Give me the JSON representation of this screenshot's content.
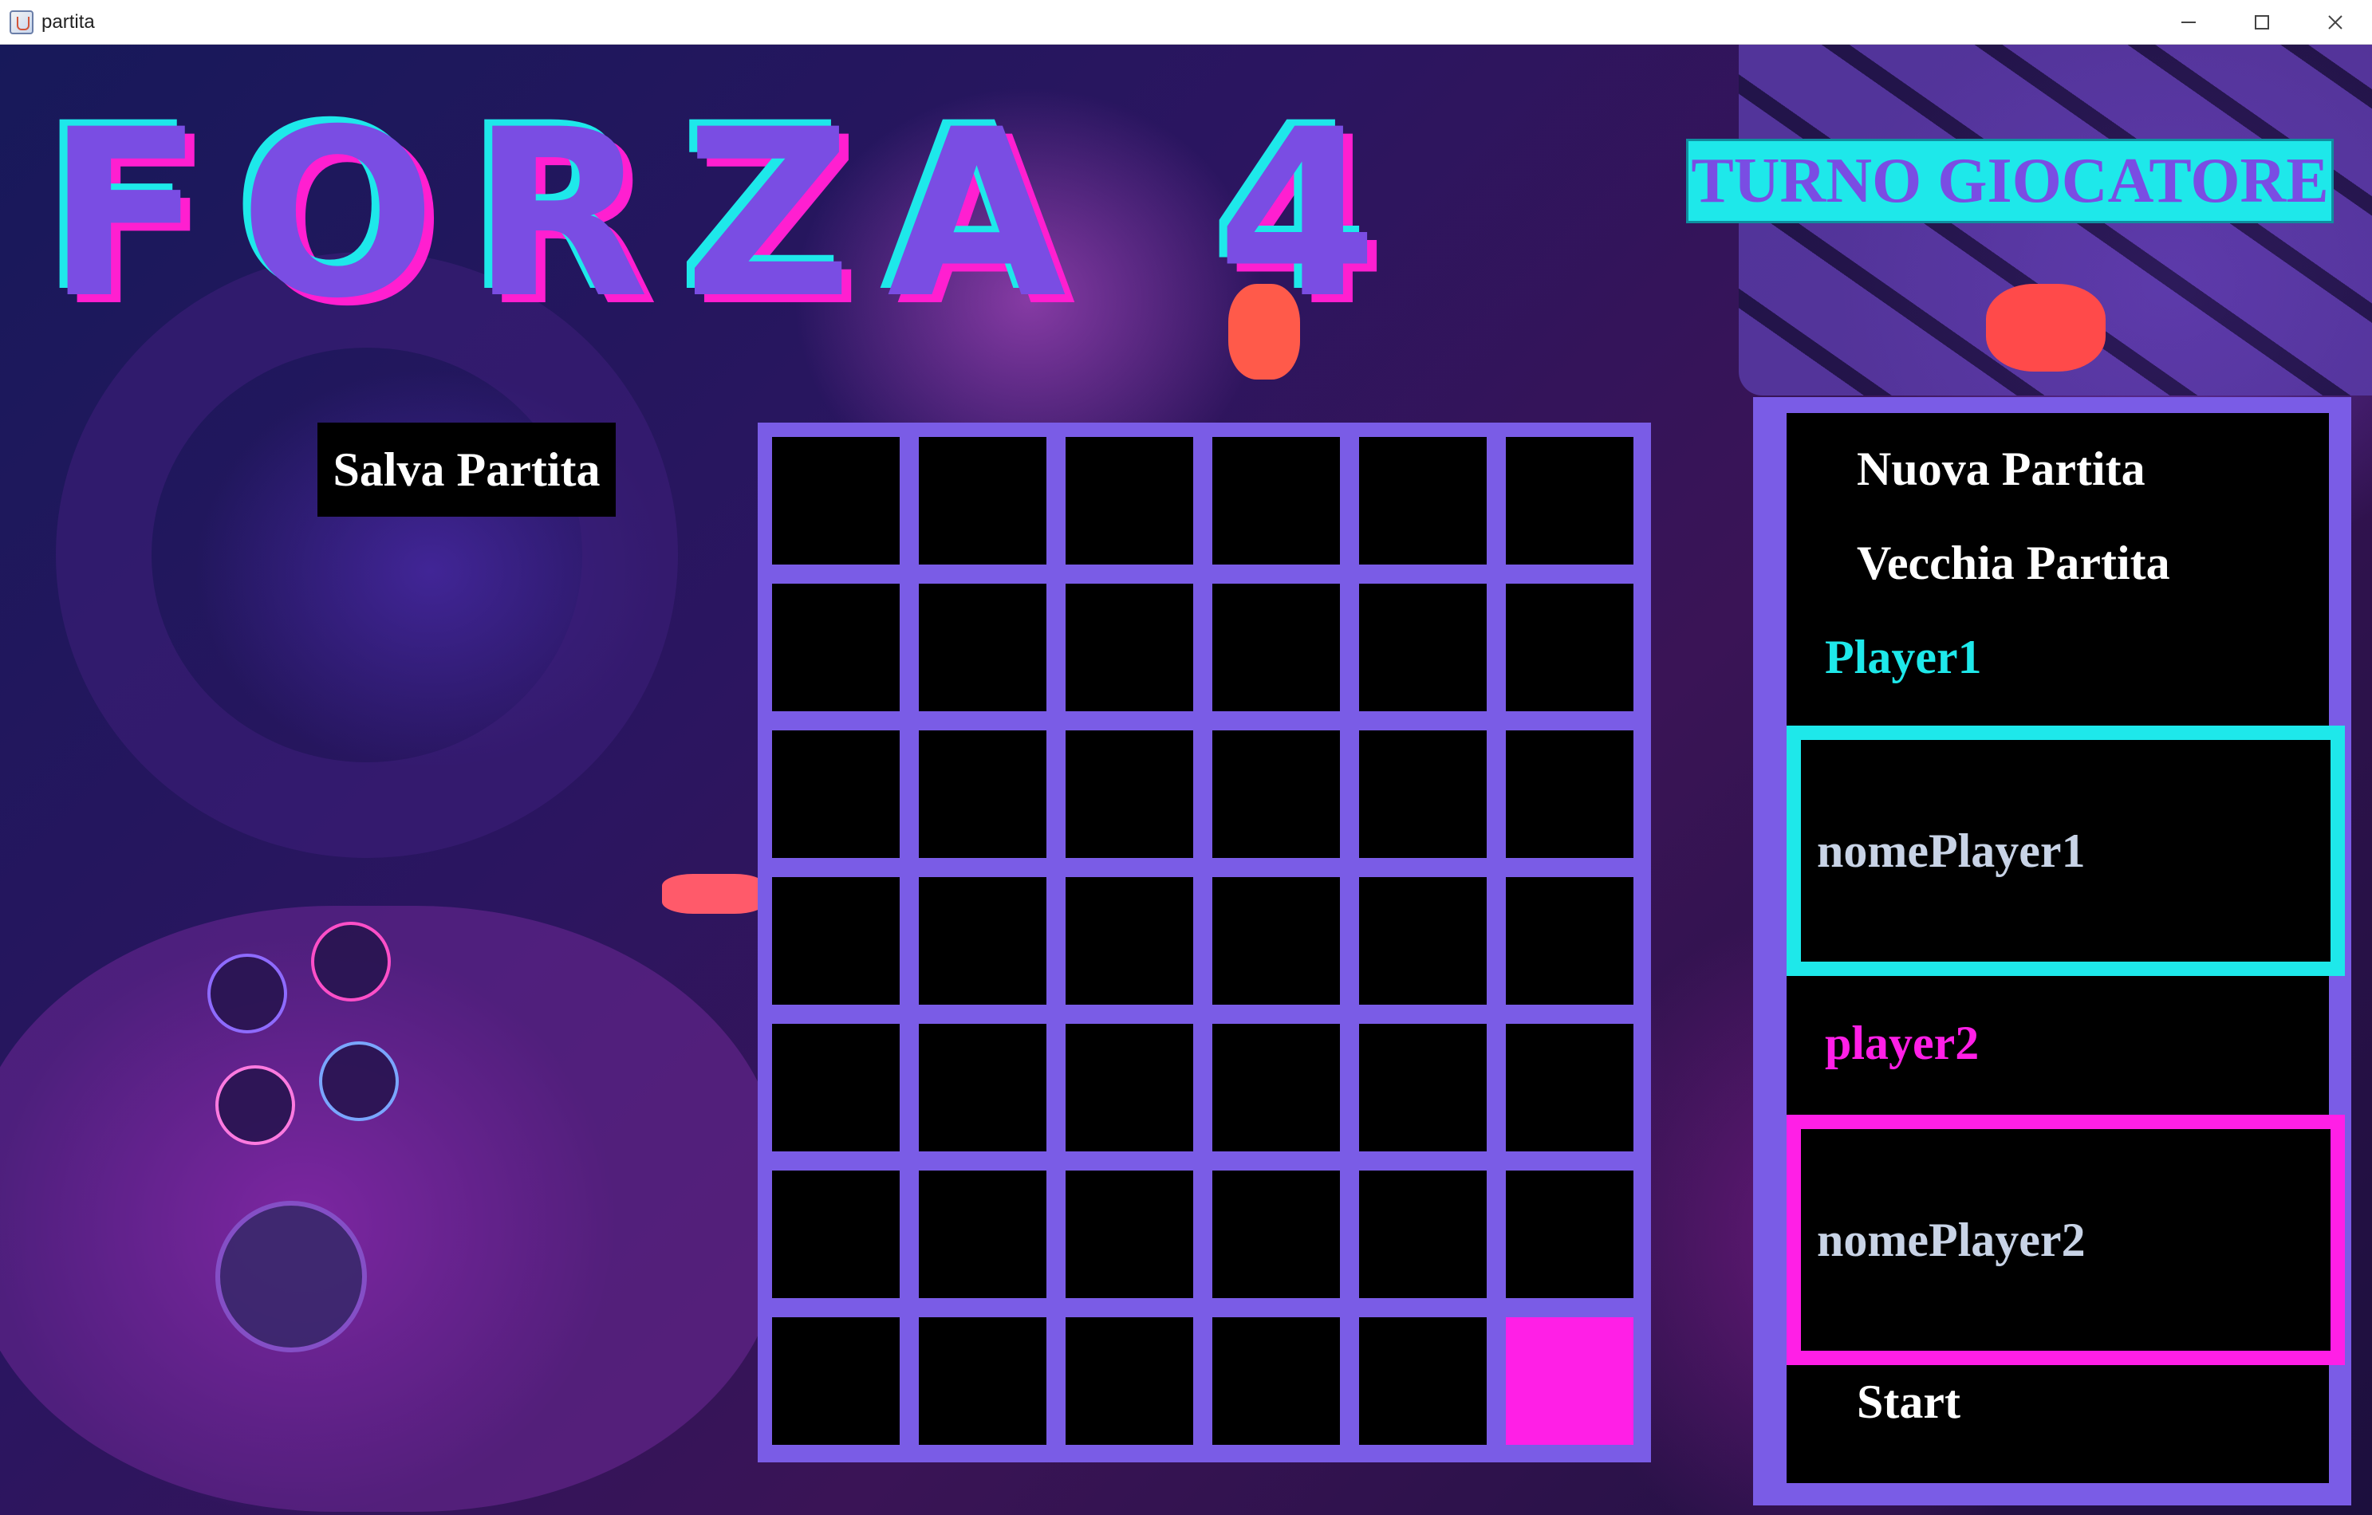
{
  "window": {
    "title": "partita"
  },
  "logo": {
    "text": "FORZA 4"
  },
  "turn": {
    "label": "TURNO GIOCATORE"
  },
  "actions": {
    "save_label": "Salva Partita"
  },
  "menu": {
    "new_game_label": "Nuova Partita",
    "old_game_label": "Vecchia Partita",
    "start_label": "Start"
  },
  "players": {
    "player1": {
      "label": "Player1",
      "name_value": "nomePlayer1",
      "color": "#1ee8ea"
    },
    "player2": {
      "label": "player2",
      "name_value": "nomePlayer2",
      "color": "#ff1fe6"
    }
  },
  "board": {
    "columns": 6,
    "rows": 7,
    "empty_color": "#000000",
    "frame_color": "#7a5ce6",
    "pieces": [
      {
        "row": 7,
        "col": 6,
        "player": "player2"
      }
    ]
  }
}
